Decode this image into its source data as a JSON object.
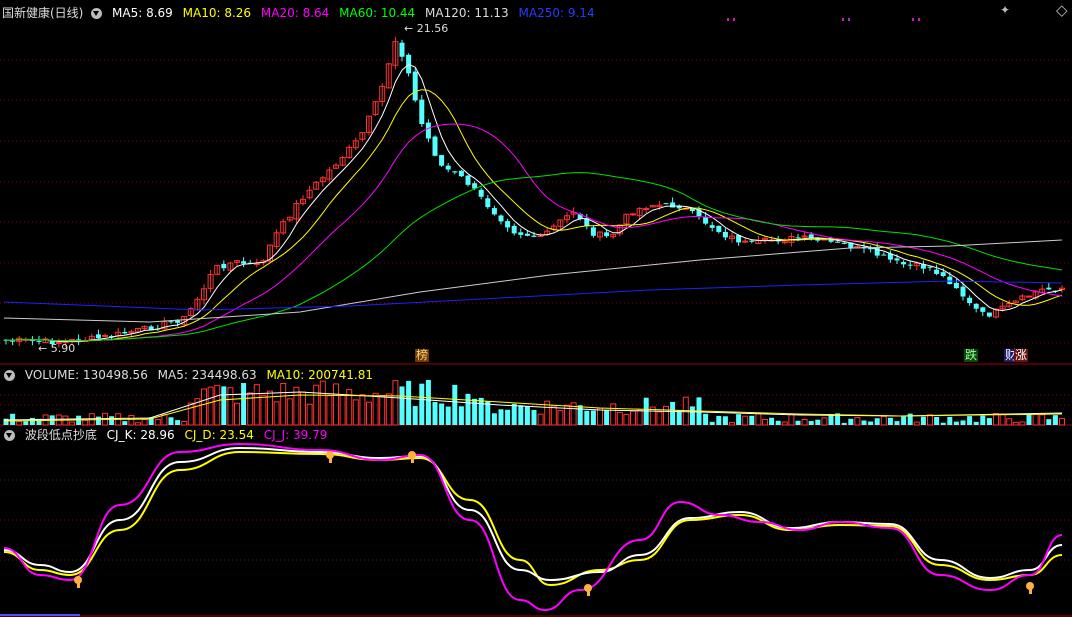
{
  "colors": {
    "up": "#ff3232",
    "down": "#54ffff",
    "ma5": "#ffffff",
    "ma10": "#ffff00",
    "ma20": "#ff00ff",
    "ma60": "#00e000",
    "ma120": "#cccccc",
    "ma250": "#2020ff",
    "grid": "#8a0000",
    "k": "#ffffff",
    "d": "#ffff00",
    "j": "#ff00ff",
    "bottom_marker": "#ffb040"
  },
  "price_panel": {
    "title": "国新健康(日线)",
    "ma5": "MA5: 8.69",
    "ma10": "MA10: 8.26",
    "ma20": "MA20: 8.64",
    "ma60": "MA60: 10.44",
    "ma120": "MA120: 11.13",
    "ma250": "MA250: 9.14",
    "high_label": "21.56",
    "low_label": "5.90",
    "tags": {
      "bang": "榜",
      "die": "跌",
      "cai": "财",
      "zhang": "涨"
    }
  },
  "volume_panel": {
    "vol": "VOLUME: 130498.56",
    "ma5": "MA5: 234498.63",
    "ma10": "MA10: 200741.81"
  },
  "indicator_panel": {
    "name": "波段低点抄底",
    "k": "CJ_K: 28.96",
    "d": "CJ_D: 23.54",
    "j": "CJ_J: 39.79"
  },
  "icons": {
    "collapse": "triangle-down-icon",
    "settings": "settings-icon",
    "close": "close-icon",
    "bottom_marker": "hand-pointer-icon"
  }
}
